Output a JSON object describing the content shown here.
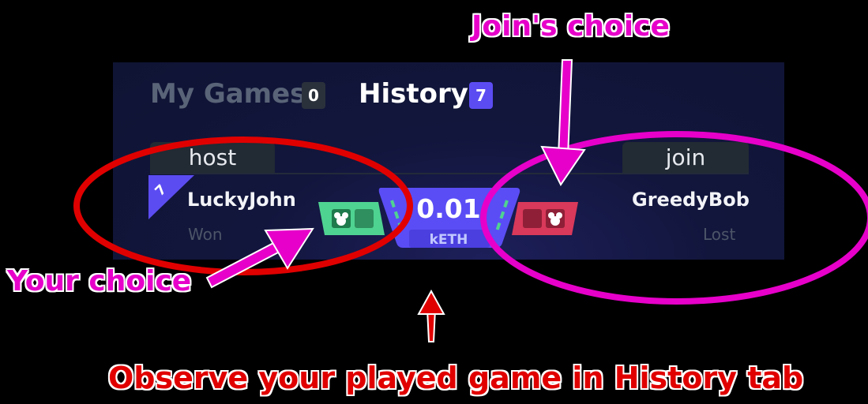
{
  "tabs": {
    "my_games": {
      "label": "My Games",
      "count": "0"
    },
    "history": {
      "label": "History",
      "count": "7"
    }
  },
  "game": {
    "host": {
      "column_label": "host",
      "name": "LuckyJohn",
      "result": "Won",
      "rank": "7"
    },
    "join": {
      "column_label": "join",
      "name": "GreedyBob",
      "result": "Lost"
    },
    "bet": {
      "amount": "0.01",
      "unit": "kETH"
    }
  },
  "annotations": {
    "join_choice": "Join's choice",
    "your_choice": "Your choice",
    "observe": "Observe your played game in History tab"
  },
  "colors": {
    "accent": "#5b4cf2",
    "host_choice": "#4fd391",
    "join_choice": "#e0405e",
    "annotation_magenta": "#e600c9",
    "annotation_red": "#e10000"
  },
  "icons": {
    "choice_symbol": "mouse-head-icon",
    "rank_marker": "rank-triangle-icon"
  }
}
